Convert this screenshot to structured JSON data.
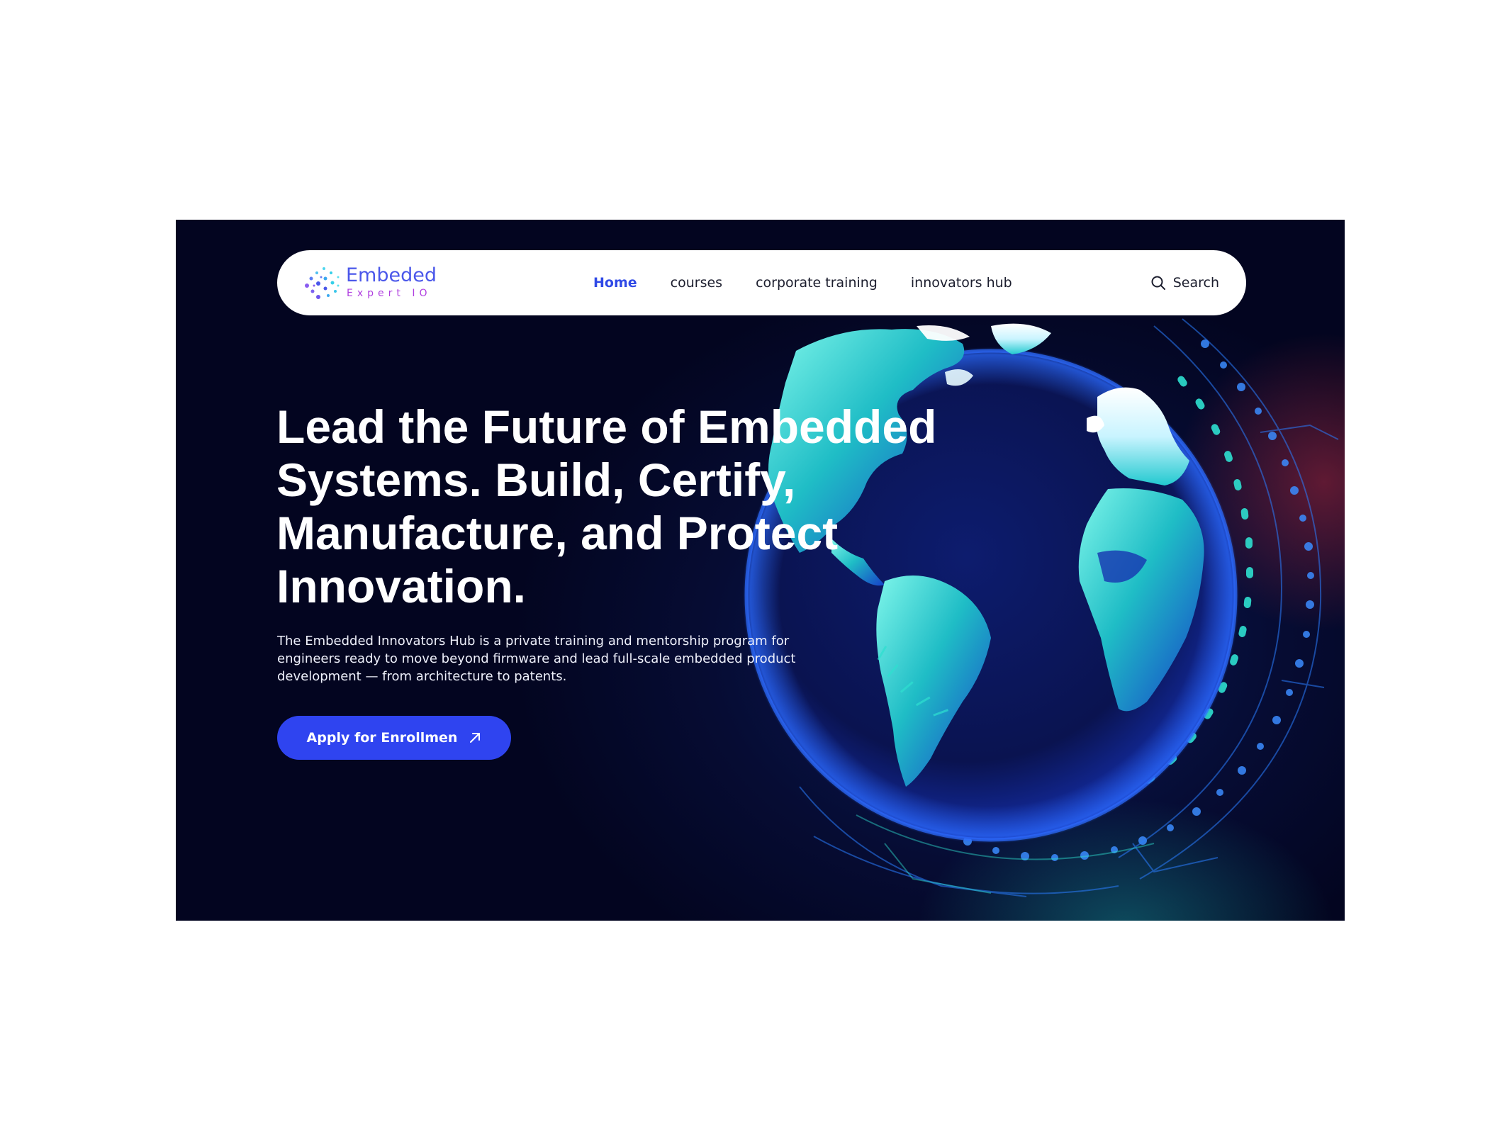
{
  "brand": {
    "name": "Embeded",
    "tagline": "Expert IO",
    "logo_icon": "particle-dots-logo",
    "colors": {
      "title": "#4a57ea",
      "tagline": "#b03fe0"
    }
  },
  "nav": {
    "items": [
      {
        "label": "Home",
        "active": true
      },
      {
        "label": "courses",
        "active": false
      },
      {
        "label": "corporate training",
        "active": false
      },
      {
        "label": "innovators hub",
        "active": false
      }
    ],
    "search": {
      "label": "Search",
      "icon": "search-icon"
    }
  },
  "hero": {
    "headline": "Lead the Future of Embedded Systems. Build, Certify, Manufacture, and Protect Innovation.",
    "description": "The Embedded Innovators Hub is a private training and mentorship program for engineers ready to move beyond firmware and lead full-scale embedded product development — from architecture to patents.",
    "cta": {
      "label": "Apply for Enrollmen",
      "icon": "arrow-up-right-icon"
    },
    "background_image": "digital-globe-circuit",
    "colors": {
      "accent": "#2f44f0",
      "active_nav": "#2f49e6",
      "background": "#030520",
      "globe_teal": "#2ee0d0"
    }
  }
}
